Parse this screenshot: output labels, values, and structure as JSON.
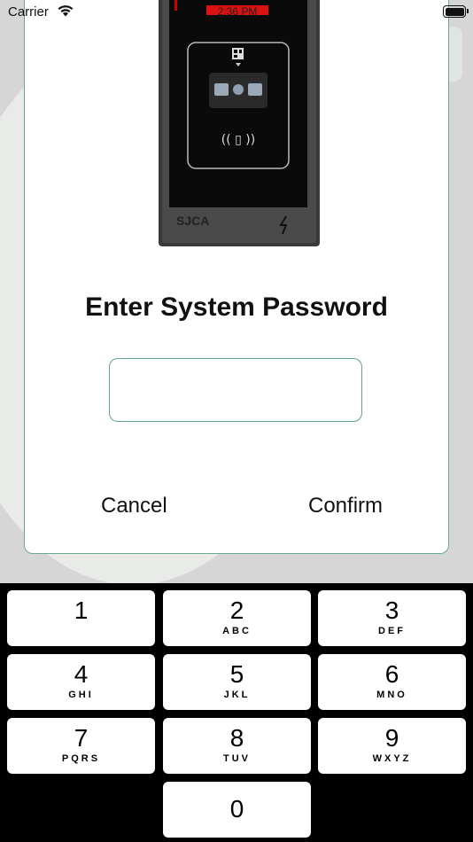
{
  "status_bar": {
    "carrier": "Carrier"
  },
  "device_image": {
    "screen_time": "2:36 PM",
    "brand": "SJCA"
  },
  "dialog": {
    "title": "Enter System Password",
    "password_value": "",
    "cancel_label": "Cancel",
    "confirm_label": "Confirm"
  },
  "keypad": {
    "keys": [
      {
        "num": "1",
        "letters": ""
      },
      {
        "num": "2",
        "letters": "ABC"
      },
      {
        "num": "3",
        "letters": "DEF"
      },
      {
        "num": "4",
        "letters": "GHI"
      },
      {
        "num": "5",
        "letters": "JKL"
      },
      {
        "num": "6",
        "letters": "MNO"
      },
      {
        "num": "7",
        "letters": "PQRS"
      },
      {
        "num": "8",
        "letters": "TUV"
      },
      {
        "num": "9",
        "letters": "WXYZ"
      },
      {
        "num": "0",
        "letters": ""
      }
    ]
  },
  "colors": {
    "accent_border": "#6aa98f",
    "keypad_background": "#000000",
    "key_background": "#ffffff"
  }
}
